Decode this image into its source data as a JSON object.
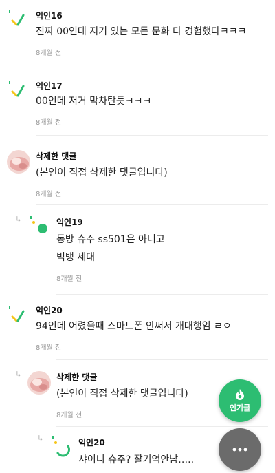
{
  "comments": [
    {
      "name": "익인16",
      "text": [
        "진짜 00인데 저기 있는 모든 문화 다 경험했다ㅋㅋㅋ"
      ],
      "time": "8개월 전",
      "avatar": "logo-icon",
      "reply": false
    },
    {
      "name": "익인17",
      "text": [
        "00인데 저거 막차탄듯ㅋㅋㅋ"
      ],
      "time": "8개월 전",
      "avatar": "logo-icon",
      "reply": false
    },
    {
      "name": "삭제한 댓글",
      "text": [
        "(본인이 직접 삭제한 댓글입니다)"
      ],
      "time": "8개월 전",
      "avatar": "profile-photo",
      "reply": false
    },
    {
      "name": "익인19",
      "text": [
        "동방 슈주 ss501은 아니고",
        "빅뱅 세대"
      ],
      "time": "8개월 전",
      "avatar": "green-dot-logo-icon",
      "reply": true
    },
    {
      "name": "익인20",
      "text": [
        "94인데 어렸을때 스마트폰 안써서 개대행임 ㄹㅇ"
      ],
      "time": "8개월 전",
      "avatar": "logo-icon",
      "reply": false
    },
    {
      "name": "삭제한 댓글",
      "text": [
        "(본인이 직접 삭제한 댓글입니다)"
      ],
      "time": "8개월 전",
      "avatar": "profile-photo",
      "reply": true
    },
    {
      "name": "익인20",
      "text": [
        "샤이니 슈주? 잘기억안남….."
      ],
      "time": "",
      "avatar": "arc-logo-icon",
      "reply": true
    }
  ],
  "fab": {
    "popular_label": "인기글",
    "popular_icon": "flame-icon",
    "more_icon": "more-dots-icon"
  },
  "colors": {
    "brand_green": "#2dbd72",
    "accent_yellow": "#f5c518",
    "more_button": "#6b6b6b"
  }
}
